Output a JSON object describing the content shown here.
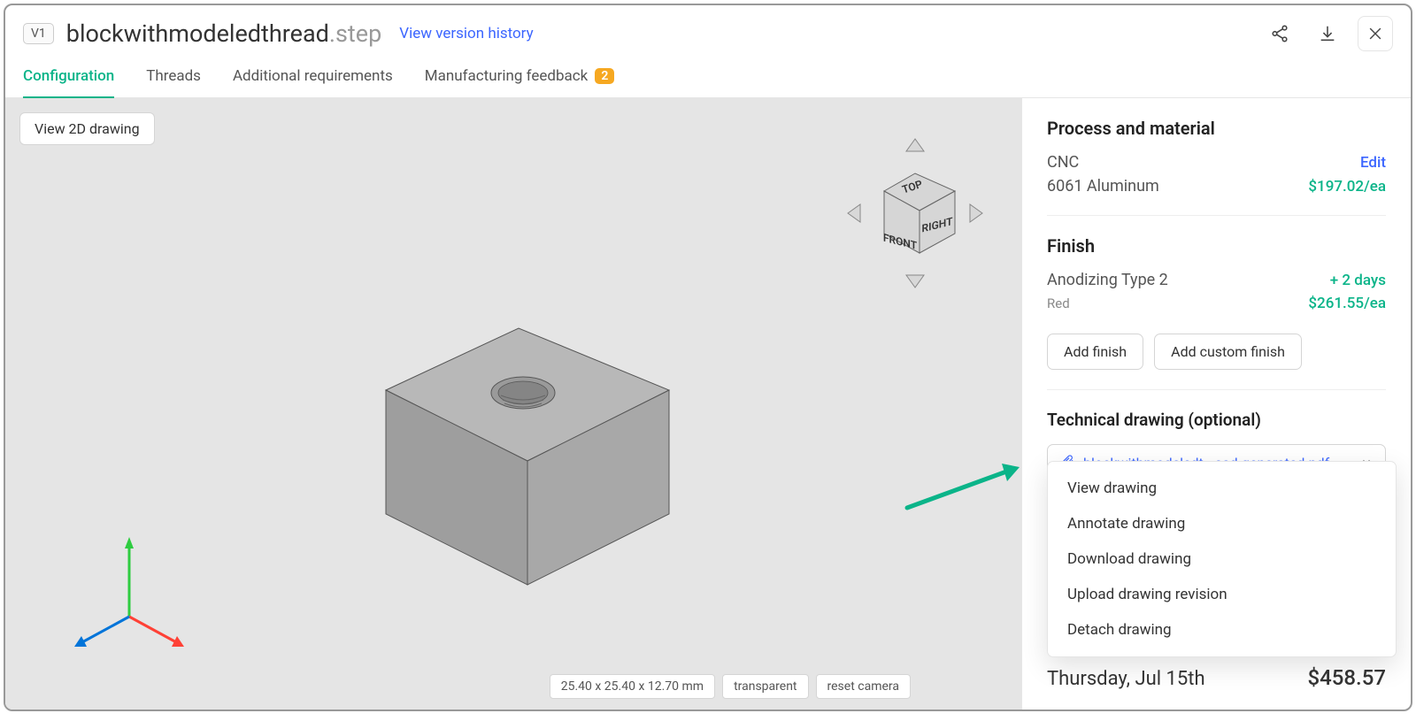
{
  "header": {
    "version_badge": "V1",
    "file_name": "blockwithmodeledthread",
    "file_ext": ".step",
    "version_history_link": "View version history"
  },
  "tabs": [
    {
      "label": "Configuration",
      "active": true
    },
    {
      "label": "Threads",
      "active": false
    },
    {
      "label": "Additional requirements",
      "active": false
    },
    {
      "label": "Manufacturing feedback",
      "active": false,
      "badge": "2"
    }
  ],
  "viewer": {
    "view_2d_button": "View 2D drawing",
    "dimensions": "25.40 x 25.40 x 12.70 mm",
    "transparent_button": "transparent",
    "reset_camera_button": "reset camera",
    "navcube": {
      "top": "TOP",
      "front": "FRONT",
      "right": "RIGHT"
    }
  },
  "sidebar": {
    "process_title": "Process and material",
    "process_name": "CNC",
    "edit_label": "Edit",
    "material_name": "6061 Aluminum",
    "process_price": "$197.02/ea",
    "finish_title": "Finish",
    "finish_name": "Anodizing Type 2",
    "finish_lead": "+ 2 days",
    "finish_color": "Red",
    "finish_price": "$261.55/ea",
    "add_finish": "Add finish",
    "add_custom_finish": "Add custom finish",
    "tech_title": "Technical drawing (optional)",
    "tech_file": "blockwithmodeledt...ead-generated.pdf",
    "dropdown": {
      "view": "View drawing",
      "annotate": "Annotate drawing",
      "download": "Download drawing",
      "upload": "Upload drawing revision",
      "detach": "Detach drawing"
    },
    "ship_date": "Thursday, Jul 15th",
    "total_price": "$458.57"
  }
}
